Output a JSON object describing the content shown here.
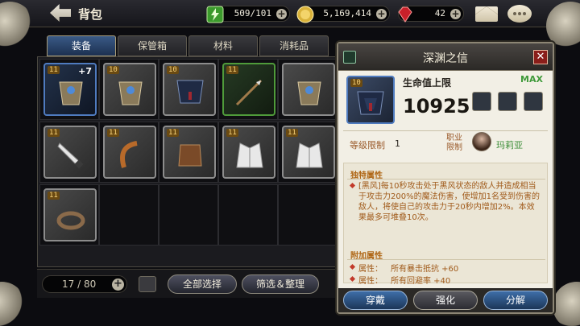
{
  "header": {
    "title": "背包",
    "energy": "509/101",
    "gold": "5,169,414",
    "gems": "42"
  },
  "tabs": [
    {
      "label": "装备",
      "active": true
    },
    {
      "label": "保管箱",
      "active": false
    },
    {
      "label": "材料",
      "active": false
    },
    {
      "label": "消耗品",
      "active": false
    }
  ],
  "grid": {
    "items": [
      {
        "level": "11",
        "plus": "+7",
        "rarity": "blue",
        "icon": "armor-icon"
      },
      {
        "level": "10",
        "plus": "",
        "rarity": "gray",
        "icon": "armor-icon"
      },
      {
        "level": "10",
        "plus": "",
        "rarity": "gray",
        "icon": "cape-icon"
      },
      {
        "level": "11",
        "plus": "",
        "rarity": "green",
        "icon": "spear-icon"
      },
      {
        "level": "",
        "plus": "",
        "rarity": "gray",
        "icon": "armor-icon"
      },
      {
        "level": "11",
        "plus": "",
        "rarity": "gray",
        "icon": "knife-icon"
      },
      {
        "level": "11",
        "plus": "",
        "rarity": "gray",
        "icon": "hook-icon"
      },
      {
        "level": "11",
        "plus": "",
        "rarity": "gray",
        "icon": "leather-icon"
      },
      {
        "level": "11",
        "plus": "",
        "rarity": "gray",
        "icon": "coat-icon"
      },
      {
        "level": "11",
        "plus": "",
        "rarity": "gray",
        "icon": "coat-icon"
      },
      {
        "level": "11",
        "plus": "",
        "rarity": "gray",
        "icon": "ring-icon"
      }
    ]
  },
  "bottom": {
    "count": "17 / 80",
    "select_all": "全部选择",
    "filter": "筛选＆整理"
  },
  "popup": {
    "title": "深渊之信",
    "item_level": "10",
    "stat_name": "生命值上限",
    "stat_value": "10925",
    "max_label": "MAX",
    "level_limit_label": "等级限制",
    "level_limit_value": "1",
    "job_label": "职业限制",
    "job_name": "玛莉亚",
    "unique_title": "独特属性",
    "unique_desc": "[黑风]每10秒攻击处于黑风状态的敌人并造成相当于攻击力200%的魔法伤害，使增加1名受到伤害的敌人，将使自己的攻击力于20秒内增加2%。本效果最多可堆叠10次。",
    "extra_title": "附加属性",
    "attr1_name": "属性：",
    "attr1_val": "所有暴击抵抗 +60",
    "attr2_name": "属性：",
    "attr2_val": "所有回避率 +40",
    "btn_equip": "穿戴",
    "btn_enhance": "强化",
    "btn_dismantle": "分解"
  },
  "colors": {
    "tab_active": "#2a4570",
    "max_green": "#3f9a3a",
    "attr_text": "#a05a1a"
  }
}
